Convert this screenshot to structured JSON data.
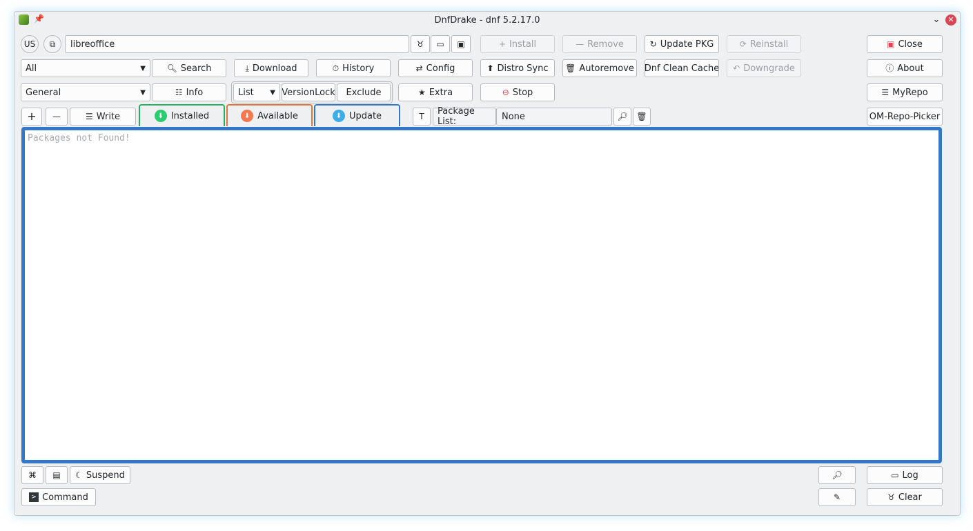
{
  "window": {
    "title": "DnfDrake - dnf 5.2.17.0"
  },
  "toolbar": {
    "lang_label": "US",
    "search_value": "libreoffice",
    "install": "Install",
    "remove": "Remove",
    "update_pkg": "Update PKG",
    "reinstall": "Reinstall",
    "close": "Close",
    "filter_selected": "All",
    "search": "Search",
    "download": "Download",
    "history": "History",
    "config": "Config",
    "distro_sync": "Distro Sync",
    "autoremove": "Autoremove",
    "clean_cache": "Dnf Clean Cache",
    "downgrade": "Downgrade",
    "about": "About",
    "category_selected": "General",
    "info": "Info",
    "list_mode_selected": "List",
    "versionlock": "VersionLock",
    "exclude": "Exclude",
    "extra": "Extra",
    "stop": "Stop",
    "myrepo": "MyRepo",
    "write": "Write",
    "package_list_label": "Package List:",
    "package_list_value": "None",
    "om_repo_picker": "OM-Repo-Picker"
  },
  "tabs": [
    {
      "label": "Installed",
      "color": "#27ae60",
      "dot": "#2ecc71"
    },
    {
      "label": "Available",
      "color": "#e0763a",
      "dot": "#f47750"
    },
    {
      "label": "Update",
      "color": "#3477c9",
      "dot": "#3daee9"
    }
  ],
  "package_area": {
    "empty_text": "Packages not Found!",
    "border_color": "#3477c9"
  },
  "bottom": {
    "suspend": "Suspend",
    "log": "Log",
    "command": "Command",
    "clear": "Clear"
  }
}
